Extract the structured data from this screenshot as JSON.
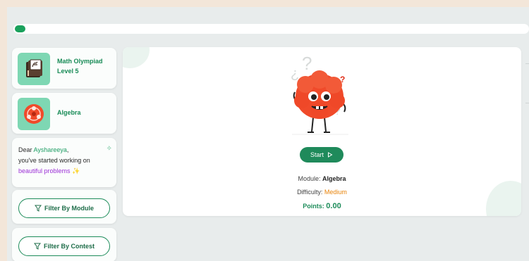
{
  "progress": {
    "fraction": 0.02,
    "color": "#1aa15c"
  },
  "sidebar": {
    "modules": [
      {
        "label": "Math Olympiad Level 5",
        "icon": "book-icon"
      },
      {
        "label": "Algebra",
        "icon": "atom-icon"
      }
    ],
    "greeting": {
      "dear": "Dear ",
      "name": "Ayshareeya",
      "comma": ",",
      "line2": "you've started working on",
      "highlight": "beautiful problems",
      "emoji": "✨"
    },
    "filters": [
      {
        "label": "Filter By Module"
      },
      {
        "label": "Filter By Contest"
      }
    ]
  },
  "main": {
    "start_label": "Start",
    "module_label": "Module:",
    "module_value": "Algebra",
    "difficulty_label": "Difficulty:",
    "difficulty_value": "Medium",
    "points_label": "Points:",
    "points_value": "0.00"
  },
  "colors": {
    "accent": "#1f8a5b",
    "brand_green": "#168a55",
    "difficulty": "#e8830a",
    "highlight": "#9b2fd6",
    "mascot": "#f04a2a"
  }
}
